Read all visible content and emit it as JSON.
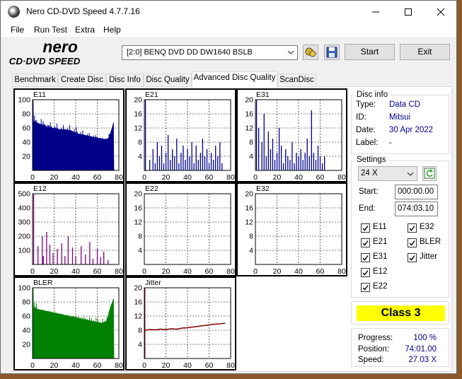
{
  "window": {
    "title": "Nero CD-DVD Speed 4.7.7.16"
  },
  "menu": [
    "File",
    "Run Test",
    "Extra",
    "Help"
  ],
  "logo": {
    "line1": "nero",
    "line2": "CD·DVD SPEED"
  },
  "drive": {
    "selected": "[2:0]   BENQ DVD DD DW1640 BSLB"
  },
  "buttons": {
    "start": "Start",
    "exit": "Exit"
  },
  "tabs": [
    "Benchmark",
    "Create Disc",
    "Disc Info",
    "Disc Quality",
    "Advanced Disc Quality",
    "ScanDisc"
  ],
  "active_tab": "Advanced Disc Quality",
  "disc_info": {
    "title": "Disc info",
    "rows": [
      {
        "label": "Type:",
        "value": "Data CD"
      },
      {
        "label": "ID:",
        "value": "Mitsui"
      },
      {
        "label": "Date:",
        "value": "30 Apr 2022"
      },
      {
        "label": "Label:",
        "value": "-"
      }
    ]
  },
  "settings": {
    "title": "Settings",
    "speed": "24 X",
    "start_label": "Start:",
    "start_value": "000:00.00",
    "end_label": "End:",
    "end_value": "074:03.10",
    "checks_left": [
      "E11",
      "E21",
      "E31",
      "E12",
      "E22"
    ],
    "checks_right": [
      "E32",
      "BLER",
      "Jitter"
    ]
  },
  "result": {
    "class": "Class 3"
  },
  "stats": [
    {
      "label": "Progress:",
      "value": "100 %"
    },
    {
      "label": "Position:",
      "value": "74:01.00"
    },
    {
      "label": "Speed:",
      "value": "27.03 X"
    }
  ],
  "colors": {
    "navy": "#00008b",
    "purple": "#800080",
    "green": "#008000",
    "maroon": "#800000",
    "class_bg": "#ffff00"
  },
  "chart_data": [
    {
      "name": "E11",
      "type": "area",
      "x_ticks": [
        0,
        20,
        40,
        60,
        80
      ],
      "y_ticks": [
        20,
        40,
        60,
        80,
        100
      ],
      "ylim": [
        0,
        100
      ],
      "xlim": [
        0,
        80
      ],
      "color": "#00008b",
      "profile": [
        [
          0,
          0
        ],
        [
          0.5,
          100
        ],
        [
          1,
          70
        ],
        [
          3,
          68
        ],
        [
          8,
          65
        ],
        [
          12,
          62
        ],
        [
          18,
          60
        ],
        [
          24,
          58
        ],
        [
          30,
          58
        ],
        [
          36,
          56
        ],
        [
          42,
          52
        ],
        [
          48,
          50
        ],
        [
          54,
          48
        ],
        [
          60,
          46
        ],
        [
          66,
          44
        ],
        [
          70,
          45
        ],
        [
          72,
          52
        ],
        [
          74,
          62
        ],
        [
          75,
          68
        ],
        [
          75.5,
          0
        ]
      ]
    },
    {
      "name": "E21",
      "type": "bar",
      "x_ticks": [
        0,
        20,
        40,
        60,
        80
      ],
      "y_ticks": [
        4,
        8,
        12,
        16,
        20
      ],
      "ylim": [
        0,
        20
      ],
      "xlim": [
        0,
        80
      ],
      "color": "#00008b",
      "spikes": [
        [
          1,
          20
        ],
        [
          5,
          3
        ],
        [
          8,
          6
        ],
        [
          10,
          2
        ],
        [
          12,
          8
        ],
        [
          14,
          4
        ],
        [
          16,
          7
        ],
        [
          18,
          2
        ],
        [
          20,
          5
        ],
        [
          22,
          10
        ],
        [
          24,
          3
        ],
        [
          26,
          6
        ],
        [
          28,
          4
        ],
        [
          30,
          9
        ],
        [
          32,
          2
        ],
        [
          34,
          5
        ],
        [
          36,
          7
        ],
        [
          38,
          3
        ],
        [
          40,
          6
        ],
        [
          42,
          4
        ],
        [
          44,
          8
        ],
        [
          46,
          2
        ],
        [
          48,
          7
        ],
        [
          50,
          3
        ],
        [
          52,
          5
        ],
        [
          54,
          9
        ],
        [
          56,
          4
        ],
        [
          58,
          6
        ],
        [
          60,
          2
        ],
        [
          62,
          5
        ],
        [
          64,
          3
        ],
        [
          66,
          7
        ],
        [
          68,
          4
        ],
        [
          70,
          8
        ],
        [
          72,
          2
        ]
      ]
    },
    {
      "name": "E31",
      "type": "bar",
      "x_ticks": [
        0,
        20,
        40,
        60,
        80
      ],
      "y_ticks": [
        4,
        8,
        12,
        16,
        20
      ],
      "ylim": [
        0,
        20
      ],
      "xlim": [
        0,
        80
      ],
      "color": "#00008b",
      "spikes": [
        [
          1,
          20
        ],
        [
          3,
          12
        ],
        [
          6,
          8
        ],
        [
          8,
          16
        ],
        [
          10,
          4
        ],
        [
          12,
          11
        ],
        [
          14,
          6
        ],
        [
          16,
          9
        ],
        [
          18,
          3
        ],
        [
          20,
          5
        ],
        [
          22,
          12
        ],
        [
          24,
          7
        ],
        [
          26,
          2
        ],
        [
          28,
          6
        ],
        [
          30,
          4
        ],
        [
          32,
          3
        ],
        [
          34,
          8
        ],
        [
          36,
          2
        ],
        [
          38,
          5
        ],
        [
          40,
          4
        ],
        [
          42,
          6
        ],
        [
          44,
          3
        ],
        [
          46,
          5
        ],
        [
          48,
          9
        ],
        [
          50,
          4
        ],
        [
          52,
          17
        ],
        [
          54,
          5
        ],
        [
          56,
          3
        ],
        [
          58,
          7
        ],
        [
          60,
          4
        ],
        [
          62,
          2
        ],
        [
          64,
          4
        ]
      ]
    },
    {
      "name": "E12",
      "type": "bar",
      "x_ticks": [
        0,
        20,
        40,
        60,
        80
      ],
      "y_ticks": [
        100,
        200,
        300,
        400,
        500
      ],
      "ylim": [
        0,
        500
      ],
      "xlim": [
        0,
        80
      ],
      "color": "#800080",
      "spikes": [
        [
          1,
          500
        ],
        [
          5,
          130
        ],
        [
          9,
          200
        ],
        [
          10,
          60
        ],
        [
          13,
          230
        ],
        [
          16,
          140
        ],
        [
          19,
          80
        ],
        [
          23,
          110
        ],
        [
          27,
          150
        ],
        [
          30,
          60
        ],
        [
          33,
          200
        ],
        [
          37,
          120
        ],
        [
          40,
          60
        ],
        [
          45,
          130
        ],
        [
          49,
          70
        ],
        [
          53,
          160
        ],
        [
          56,
          40
        ],
        [
          60,
          110
        ],
        [
          63,
          50
        ],
        [
          66,
          90
        ],
        [
          70,
          30
        ]
      ]
    },
    {
      "name": "E22",
      "type": "bar",
      "x_ticks": [
        0,
        20,
        40,
        60,
        80
      ],
      "y_ticks": [
        4,
        8,
        12,
        16,
        20
      ],
      "ylim": [
        0,
        20
      ],
      "xlim": [
        0,
        80
      ],
      "color": "#800080",
      "spikes": []
    },
    {
      "name": "E32",
      "type": "bar",
      "x_ticks": [
        0,
        20,
        40,
        60,
        80
      ],
      "y_ticks": [
        4,
        8,
        12,
        16,
        20
      ],
      "ylim": [
        0,
        20
      ],
      "xlim": [
        0,
        80
      ],
      "color": "#800080",
      "spikes": []
    },
    {
      "name": "BLER",
      "type": "area",
      "x_ticks": [
        0,
        20,
        40,
        60,
        80
      ],
      "y_ticks": [
        20,
        40,
        60,
        80,
        100
      ],
      "ylim": [
        0,
        100
      ],
      "xlim": [
        0,
        80
      ],
      "color": "#008000",
      "profile": [
        [
          0,
          0
        ],
        [
          0.5,
          100
        ],
        [
          1,
          72
        ],
        [
          4,
          70
        ],
        [
          10,
          68
        ],
        [
          16,
          66
        ],
        [
          22,
          64
        ],
        [
          28,
          62
        ],
        [
          34,
          60
        ],
        [
          40,
          58
        ],
        [
          46,
          56
        ],
        [
          52,
          54
        ],
        [
          58,
          52
        ],
        [
          64,
          50
        ],
        [
          68,
          52
        ],
        [
          70,
          60
        ],
        [
          72,
          72
        ],
        [
          74,
          80
        ],
        [
          75,
          85
        ],
        [
          75.5,
          0
        ]
      ]
    },
    {
      "name": "Jitter",
      "type": "line",
      "x_ticks": [
        0,
        20,
        40,
        60,
        80
      ],
      "y_ticks": [
        4,
        8,
        12,
        16,
        20
      ],
      "ylim": [
        0,
        20
      ],
      "xlim": [
        0,
        80
      ],
      "color": "#800000",
      "points": [
        [
          1,
          8.0
        ],
        [
          5,
          8.2
        ],
        [
          10,
          8.1
        ],
        [
          15,
          8.3
        ],
        [
          20,
          8.2
        ],
        [
          25,
          8.4
        ],
        [
          30,
          8.3
        ],
        [
          35,
          8.6
        ],
        [
          40,
          8.7
        ],
        [
          45,
          8.9
        ],
        [
          50,
          9.1
        ],
        [
          55,
          9.3
        ],
        [
          60,
          9.5
        ],
        [
          65,
          9.7
        ],
        [
          70,
          9.8
        ],
        [
          75,
          10.0
        ]
      ]
    }
  ]
}
